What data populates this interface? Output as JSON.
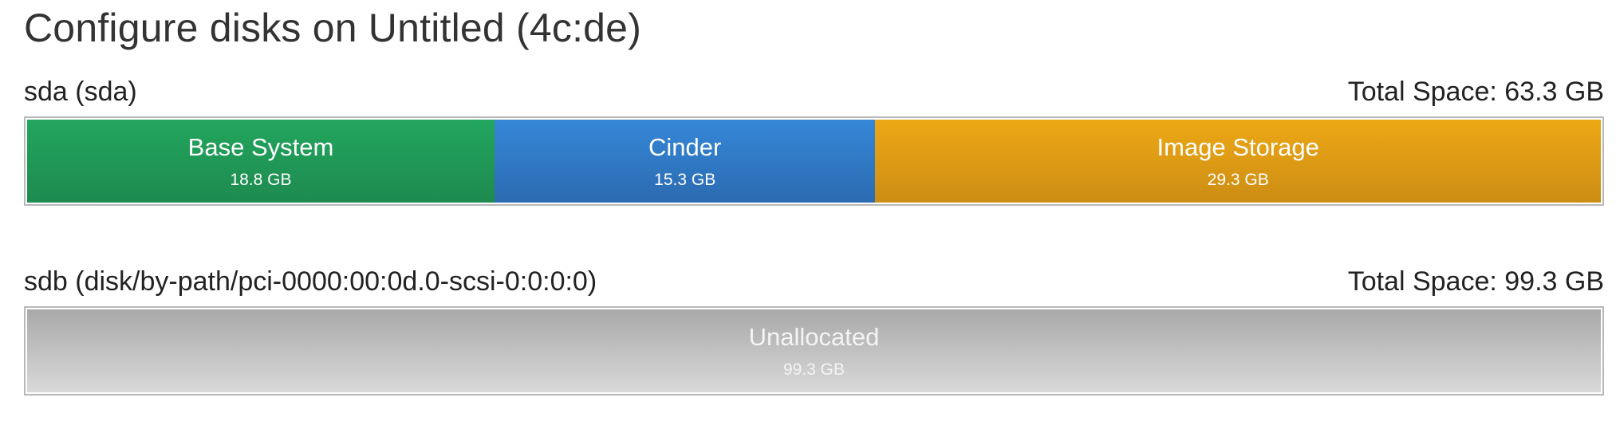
{
  "page": {
    "title": "Configure disks on Untitled (4c:de)"
  },
  "disks": [
    {
      "name": "sda (sda)",
      "total_space": "Total Space: 63.3 GB",
      "volumes": [
        {
          "name": "Base System",
          "size": "18.8 GB",
          "color": "#22a65e",
          "share": 0.297
        },
        {
          "name": "Cinder",
          "size": "15.3 GB",
          "color": "#3587d7",
          "share": 0.242
        },
        {
          "name": "Image Storage",
          "size": "29.3 GB",
          "color": "#eea815",
          "share": 0.461
        }
      ]
    },
    {
      "name": "sdb (disk/by-path/pci-0000:00:0d.0-scsi-0:0:0:0)",
      "total_space": "Total Space: 99.3 GB",
      "volumes": [
        {
          "name": "Unallocated",
          "size": "99.3 GB",
          "color": "#c0c0c0",
          "share": 1.0
        }
      ]
    }
  ]
}
